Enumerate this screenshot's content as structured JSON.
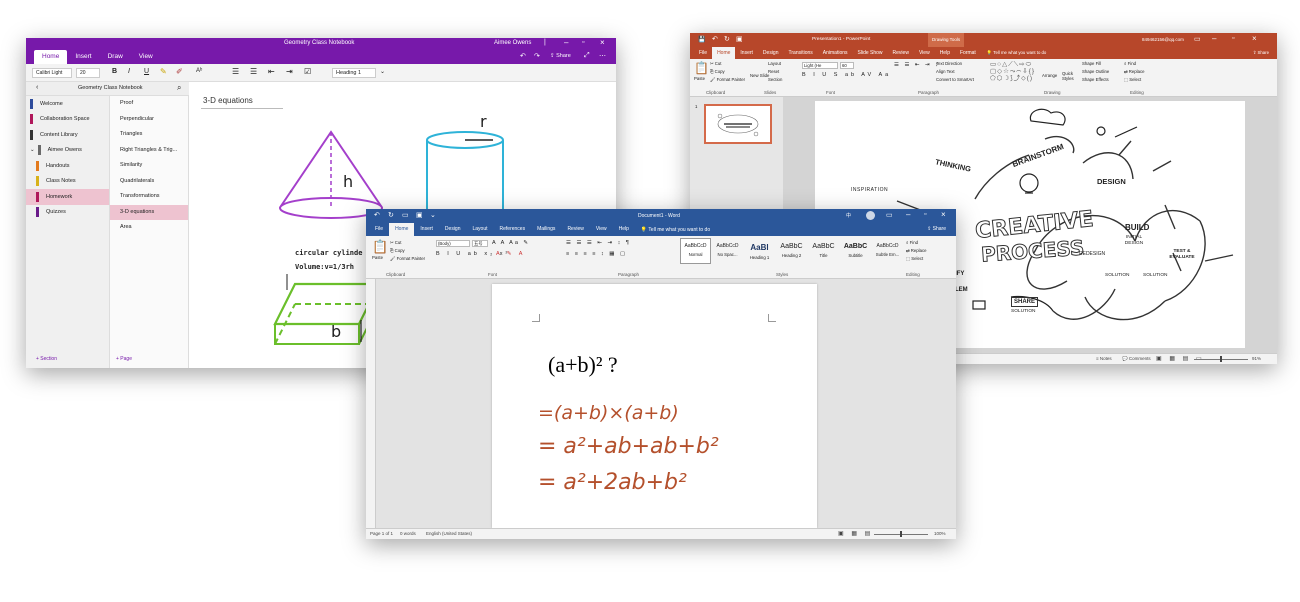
{
  "onenote": {
    "title": "Geometry Class Notebook",
    "user": "Aimee Owens",
    "tabs": [
      "Home",
      "Insert",
      "Draw",
      "View"
    ],
    "share": "Share",
    "font_name": "Calibri Light",
    "font_size": "20",
    "style": "Heading 1",
    "notebook": "Geometry Class Notebook",
    "sections": [
      {
        "label": "Welcome",
        "color": "#2e4b9b"
      },
      {
        "label": "Collaboration Space",
        "color": "#b0175a"
      },
      {
        "label": "Content Library",
        "color": "#333333"
      },
      {
        "label": "Aimee Owens",
        "color": "#6a6a6a"
      },
      {
        "label": "Handouts",
        "color": "#e37a1d"
      },
      {
        "label": "Class Notes",
        "color": "#d8b21a"
      },
      {
        "label": "Homework",
        "color": "#b0175a"
      },
      {
        "label": "Quizzes",
        "color": "#6a1b8a"
      }
    ],
    "pages": [
      "Proof",
      "Perpendicular",
      "Triangles",
      "Right Triangles & Trig...",
      "Similarity",
      "Quadrilaterals",
      "Transformations",
      "3-D equations",
      "Area"
    ],
    "page_title": "3-D equations",
    "ink_h": "h",
    "ink_r": "r",
    "ink_b": "b",
    "ink_text1": "circular cylinde",
    "ink_text2": "Volume:v=1/3rh",
    "add_section": "+ Section",
    "add_page": "+ Page",
    "accent": "#7719aa"
  },
  "powerpoint": {
    "title": "Presentation1 - PowerPoint",
    "context_tab": "Drawing Tools",
    "tell_me": "Tell me what you want to do",
    "account": "849462156@qq.com",
    "tabs": [
      "File",
      "Home",
      "Insert",
      "Design",
      "Transitions",
      "Animations",
      "Slide Show",
      "Review",
      "View",
      "Help",
      "Format"
    ],
    "share": "Share",
    "ribbon": {
      "paste": "Paste",
      "cut": "Cut",
      "copy": "Copy",
      "format_painter": "Format Painter",
      "new_slide": "New Slide",
      "layout": "Layout",
      "reset": "Reset",
      "section": "Section",
      "font": "Light (He",
      "font_size": "60",
      "text_direction": "Text Direction",
      "align_text": "Align Text",
      "smartart": "Convert to SmartArt",
      "arrange": "Arrange",
      "quick_styles": "Quick Styles",
      "shape_fill": "Shape Fill",
      "shape_outline": "Shape Outline",
      "shape_effects": "Shape Effects",
      "find": "Find",
      "replace": "Replace",
      "select": "Select",
      "groups": [
        "Clipboard",
        "Slides",
        "Font",
        "Paragraph",
        "Drawing",
        "Editing"
      ]
    },
    "slide_number": "1",
    "slide_words": {
      "inspiration": "INSPIRATION",
      "thinking": "THINKING",
      "brainstorm": "BRAINSTORM",
      "design": "DESIGN",
      "creative": "CREATIVE",
      "process": "PROCESS",
      "build": "BUILD",
      "initial_design": "INITIAL DESIGN",
      "redesign": "REDESIGN",
      "test_evaluate": "TEST & EVALUATE",
      "solution": "SOLUTION",
      "share": "SHARE",
      "share_solution": "SOLUTION",
      "ify": "IFY",
      "lem": "LEM"
    },
    "status": {
      "notes": "Notes",
      "comments": "Comments",
      "zoom": "91%"
    },
    "accent": "#b7472a"
  },
  "word": {
    "title": "Document1 - Word",
    "tabs": [
      "File",
      "Home",
      "Insert",
      "Design",
      "Layout",
      "References",
      "Mailings",
      "Review",
      "View",
      "Help"
    ],
    "tell_me": "Tell me what you want to do",
    "share": "Share",
    "ribbon": {
      "paste": "Paste",
      "cut": "Cut",
      "copy": "Copy",
      "format_painter": "Format Painter",
      "font": "(Body)",
      "font_size": "五号",
      "find": "Find",
      "replace": "Replace",
      "select": "Select",
      "groups": [
        "Clipboard",
        "Font",
        "Paragraph",
        "Styles",
        "Editing"
      ],
      "styles": [
        {
          "preview": "AaBbCcD",
          "name": "Normal"
        },
        {
          "preview": "AaBbCcD",
          "name": "No Spac..."
        },
        {
          "preview": "AaBl",
          "name": "Heading 1"
        },
        {
          "preview": "AaBbC",
          "name": "Heading 2"
        },
        {
          "preview": "AaBbC",
          "name": "Title"
        },
        {
          "preview": "AaBbC",
          "name": "Subtitle"
        },
        {
          "preview": "AaBbCcD",
          "name": "Subtle Em..."
        }
      ]
    },
    "doc_text": "(a+b)² ?",
    "ink": [
      "=(a+b)×(a+b)",
      "= a²+ab+ab+b²",
      "= a²+2ab+b²"
    ],
    "status": {
      "page": "Page 1 of 1",
      "words": "0 words",
      "language": "English (United States)",
      "zoom": "100%"
    },
    "accent": "#2b579a",
    "ink_color": "#b4502c"
  }
}
